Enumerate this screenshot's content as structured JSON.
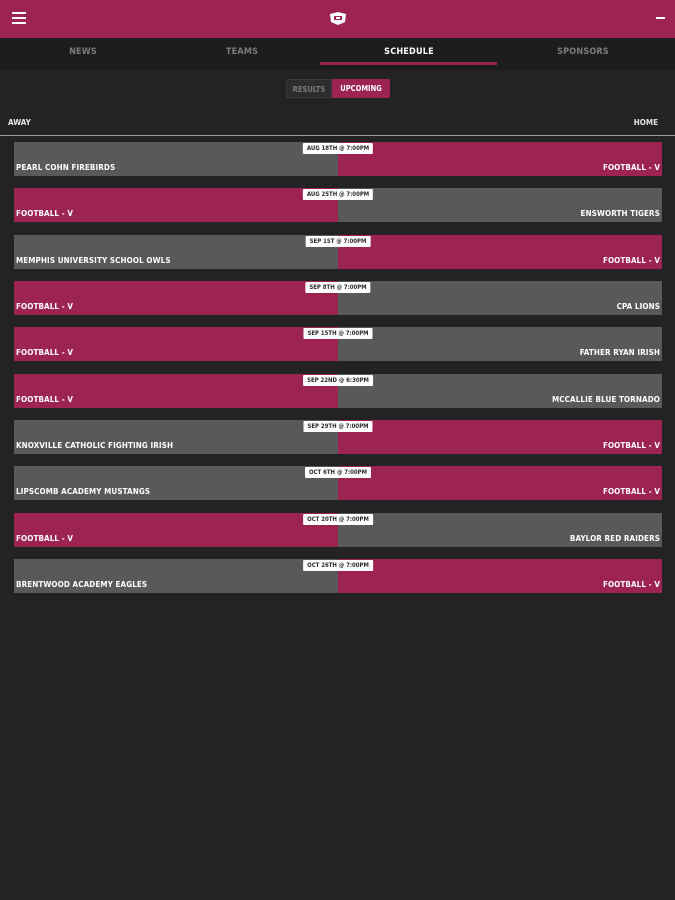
{
  "header": {
    "menu_icon": "hamburger-menu-icon",
    "logo_icon": "school-logo-icon",
    "minus_icon": "minus-icon",
    "color": "#9c2352"
  },
  "tabs": [
    {
      "label": "NEWS"
    },
    {
      "label": "TEAMS"
    },
    {
      "label": "SCHEDULE"
    },
    {
      "label": "SPONSORS"
    }
  ],
  "segment": {
    "results": "RESULTS",
    "upcoming": "UPCOMING"
  },
  "columns": {
    "away": "AWAY",
    "home": "HOME"
  },
  "games": [
    {
      "date": "AUG 18TH @ 7:00PM",
      "away": "PEARL COHN FIREBIRDS",
      "home": "FOOTBALL - V"
    },
    {
      "date": "AUG 25TH @ 7:00PM",
      "away": "FOOTBALL - V",
      "home": "ENSWORTH TIGERS"
    },
    {
      "date": "SEP 1ST @ 7:00PM",
      "away": "MEMPHIS UNIVERSITY SCHOOL OWLS",
      "home": "FOOTBALL - V"
    },
    {
      "date": "SEP 8TH @ 7:00PM",
      "away": "FOOTBALL - V",
      "home": "CPA LIONS"
    },
    {
      "date": "SEP 15TH @ 7:00PM",
      "away": "FOOTBALL - V",
      "home": "FATHER RYAN IRISH"
    },
    {
      "date": "SEP 22ND @ 6:30PM",
      "away": "FOOTBALL - V",
      "home": "MCCALLIE BLUE TORNADO"
    },
    {
      "date": "SEP 29TH @ 7:00PM",
      "away": "KNOXVILLE CATHOLIC FIGHTING IRISH",
      "home": "FOOTBALL - V"
    },
    {
      "date": "OCT 6TH @ 7:00PM",
      "away": "LIPSCOMB ACADEMY MUSTANGS",
      "home": "FOOTBALL - V"
    },
    {
      "date": "OCT 20TH @ 7:00PM",
      "away": "FOOTBALL - V",
      "home": "BAYLOR RED RAIDERS"
    },
    {
      "date": "OCT 26TH @ 7:00PM",
      "away": "BRENTWOOD ACADEMY EAGLES",
      "home": "FOOTBALL - V"
    }
  ]
}
